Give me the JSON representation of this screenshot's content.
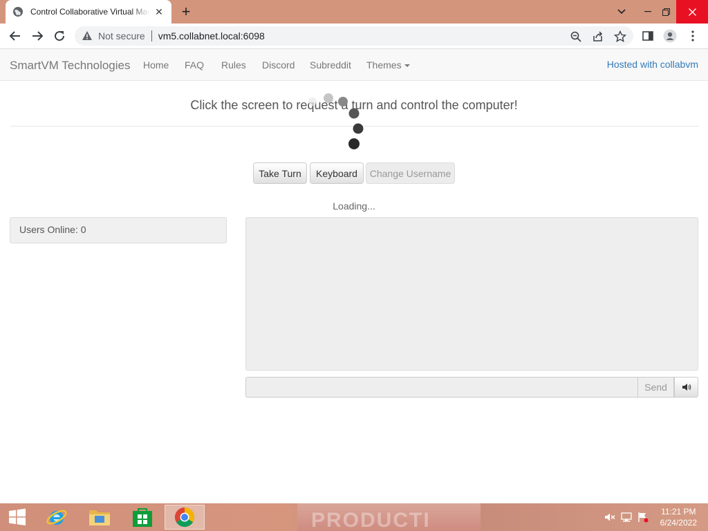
{
  "browser": {
    "tab_title": "Control Collaborative Virtual Machines",
    "new_tab": "+",
    "security_label": "Not secure",
    "url": "vm5.collabnet.local:6098"
  },
  "navbar": {
    "brand": "SmartVM Technologies",
    "items": [
      {
        "label": "Home"
      },
      {
        "label": "FAQ"
      },
      {
        "label": "Rules"
      },
      {
        "label": "Discord"
      },
      {
        "label": "Subreddit"
      },
      {
        "label": "Themes"
      }
    ],
    "hosted": "Hosted with collabvm"
  },
  "main": {
    "headline": "Click the screen to request a turn and control the computer!",
    "buttons": {
      "take_turn": "Take Turn",
      "keyboard": "Keyboard",
      "change_username": "Change Username"
    },
    "loading": "Loading...",
    "users_online": "Users Online: 0",
    "chat_input_value": "",
    "send": "Send"
  },
  "taskbar": {
    "time": "11:21 PM",
    "date": "6/24/2022",
    "wallpaper_text": "PRODUCTI"
  },
  "colors": {
    "tab_strip": "#d3957c",
    "link": "#337ab7",
    "close_red": "#e81123"
  }
}
